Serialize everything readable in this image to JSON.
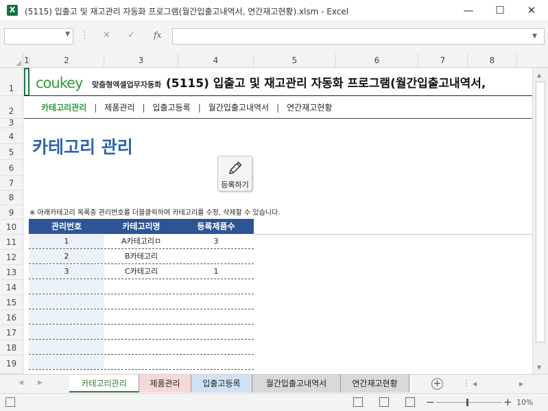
{
  "window": {
    "title": "(5115) 입출고 및 재고관리 자동화 프로그램(월간입출고내역서, 연간재고현황).xlsm - Excel",
    "app_icon": "X",
    "minimize": "—",
    "maximize": "☐",
    "close": "✕"
  },
  "formula_bar": {
    "name_box": "",
    "cancel": "✕",
    "enter": "✓",
    "fx": "fx",
    "content": ""
  },
  "columns": [
    "1",
    "2",
    "3",
    "4",
    "5",
    "6",
    "7",
    "8"
  ],
  "rows": [
    "1",
    "2",
    "3",
    "4",
    "5",
    "6",
    "7",
    "8",
    "9",
    "10",
    "11",
    "12",
    "13",
    "14",
    "15",
    "16",
    "17",
    "18",
    "19"
  ],
  "header": {
    "logo": "coukey",
    "logo_sub": "맞춤형엑셀업무자동화",
    "title": "(5115) 입출고 및 재고관리 자동화 프로그램(월간입출고내역서,"
  },
  "nav": {
    "items": [
      "카테고리관리",
      "제품관리",
      "입출고등록",
      "월간입출고내역서",
      "연간재고현황"
    ],
    "separator": "|"
  },
  "page_title": "카테고리 관리",
  "register_button": {
    "label": "등록하기",
    "icon": "pencil-icon"
  },
  "notice": "※ 아래카테고리 목록중 관리번호를 더블클릭하여 카테고리를 수정, 삭제할 수 있습니다.",
  "table": {
    "headers": [
      "관리번호",
      "카테고리명",
      "등록제품수"
    ],
    "rows": [
      [
        "1",
        "A카테고리ㅁ",
        "3"
      ],
      [
        "2",
        "B카테고리",
        ""
      ],
      [
        "3",
        "C카테고리",
        "1"
      ],
      [
        "",
        "",
        ""
      ],
      [
        "",
        "",
        ""
      ],
      [
        "",
        "",
        ""
      ],
      [
        "",
        "",
        ""
      ],
      [
        "",
        "",
        ""
      ],
      [
        "",
        "",
        ""
      ]
    ]
  },
  "sheet_tabs": [
    "카테고리관리",
    "제품관리",
    "입출고등록",
    "월간입출고내역서",
    "연간재고현황"
  ],
  "sheet_tab_colors": [
    "#ffffff",
    "#f8d7da",
    "#cfe2f3",
    "#d9d9d9",
    "#d9d9d9"
  ],
  "status": {
    "zoom_minus": "−",
    "zoom_plus": "+",
    "zoom": "10%"
  },
  "colors": {
    "accent_green": "#2e9a3a",
    "title_blue": "#2e64ad",
    "table_header": "#2d5596"
  }
}
